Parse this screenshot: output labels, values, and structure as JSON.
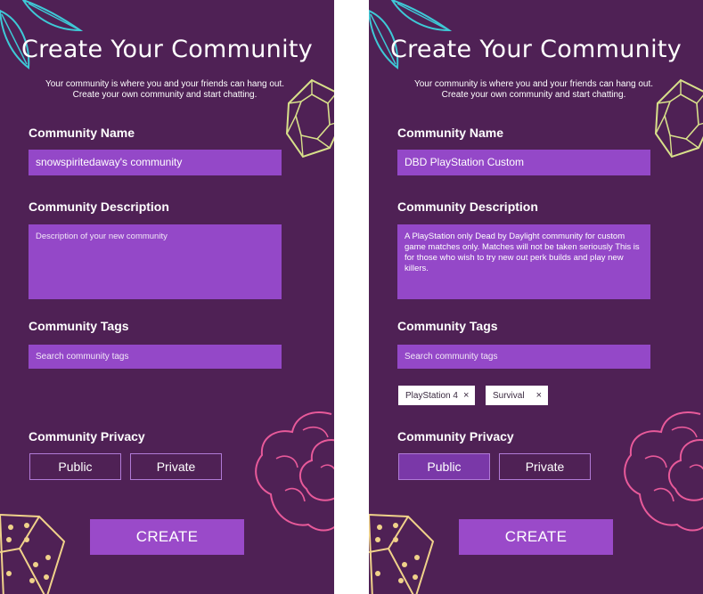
{
  "screens": [
    {
      "title": "Create Your Community",
      "subtitle": "Your community is where you and your friends can hang out. Create your own community and start chatting.",
      "name_label": "Community Name",
      "name_value": "snowspiritedaway's community",
      "description_label": "Community Description",
      "description_value": "",
      "description_placeholder": "Description of your new community",
      "tags_label": "Community Tags",
      "tags_placeholder": "Search community tags",
      "tags": [],
      "privacy_label": "Community Privacy",
      "privacy_options": [
        "Public",
        "Private"
      ],
      "privacy_selected": "",
      "create_label": "CREATE"
    },
    {
      "title": "Create Your Community",
      "subtitle": "Your community is where you and your friends can hang out. Create your own community and start chatting.",
      "name_label": "Community Name",
      "name_value": "DBD PlayStation Custom",
      "description_label": "Community Description",
      "description_value": "A PlayStation only Dead by Daylight community for custom game matches only. Matches will not be taken seriously This is for those who wish to try new out perk builds and play new killers.",
      "description_placeholder": "",
      "tags_label": "Community Tags",
      "tags_placeholder": "Search community tags",
      "tags": [
        {
          "label": "PlayStation 4",
          "remove": "×"
        },
        {
          "label": "Survival",
          "remove": "×"
        }
      ],
      "privacy_label": "Community Privacy",
      "privacy_options": [
        "Public",
        "Private"
      ],
      "privacy_selected": "Public",
      "create_label": "CREATE"
    }
  ],
  "colors": {
    "background": "#4f2155",
    "field": "#9448c8",
    "button": "#9a4ac9",
    "leaf": "#3ec9d6",
    "gem": "#d8e08a",
    "rose": "#e85a9a",
    "dice": "#f0d28a"
  },
  "icons": [
    "leaf-icon",
    "gem-icon",
    "rose-icon",
    "dice-icon",
    "close-icon"
  ]
}
